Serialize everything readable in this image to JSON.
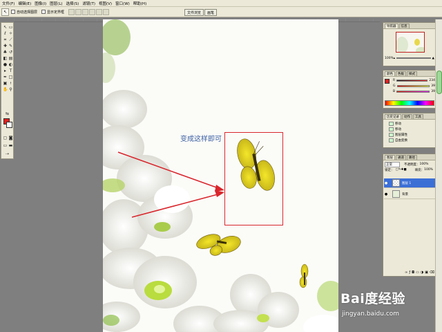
{
  "menu": [
    "文件(F)",
    "编辑(E)",
    "图像(I)",
    "图层(L)",
    "选择(S)",
    "滤镜(T)",
    "视图(V)",
    "窗口(W)",
    "帮助(H)"
  ],
  "options": {
    "auto_select_layer": "自动选择图层",
    "show_bounding_box": "显示定界框"
  },
  "wells": [
    "文件浏览",
    "画笔"
  ],
  "annotation": {
    "label": "变成这样即可",
    "highlight_color": "#d9262c",
    "text_color": "#3b5fa3"
  },
  "navigator": {
    "tabs": [
      "导航器",
      "信息"
    ],
    "zoom": "100%"
  },
  "color_panel": {
    "tabs": [
      "颜色",
      "色板",
      "样式"
    ],
    "r": {
      "label": "R",
      "value": "234"
    },
    "g": {
      "label": "G",
      "value": "39"
    },
    "b": {
      "label": "B",
      "value": "39"
    },
    "foreground": "#e21f1f"
  },
  "history": {
    "tabs": [
      "历史记录",
      "动作",
      "工具"
    ],
    "items": [
      "移动",
      "移动",
      "图层属性",
      "自由变换"
    ]
  },
  "layers": {
    "tabs": [
      "图层",
      "通道",
      "路径"
    ],
    "blend_mode": "正常",
    "opacity_label": "不透明度：",
    "opacity": "100%",
    "lock_label": "锁定：",
    "fill_label": "填充：",
    "fill": "100%",
    "items": [
      {
        "name": "图层 1",
        "selected": true
      },
      {
        "name": "背景",
        "selected": false
      }
    ]
  },
  "watermark": {
    "logo": "Bai度经验",
    "url": "jingyan.baidu.com"
  }
}
